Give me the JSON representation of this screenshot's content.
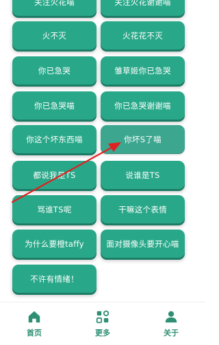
{
  "buttons": [
    {
      "label": "关注火花喵"
    },
    {
      "label": "关注火花谢谢喵"
    },
    {
      "label": "火不灭"
    },
    {
      "label": "火花花不灭"
    },
    {
      "label": "你已急哭"
    },
    {
      "label": "雏草姬你已急哭"
    },
    {
      "label": "你已急哭喵"
    },
    {
      "label": "你已急哭谢谢喵"
    },
    {
      "label": "你这个坏东西喵"
    },
    {
      "label": "你坏S了喵"
    },
    {
      "label": "都说我是TS"
    },
    {
      "label": "说谁是TS"
    },
    {
      "label": "骂谁TS呢"
    },
    {
      "label": "干嘛这个表情"
    },
    {
      "label": "为什么要橙taffy"
    },
    {
      "label": "面对摄像头要开心喵"
    },
    {
      "label": "不许有情绪！"
    }
  ],
  "nav": {
    "home": "首页",
    "more": "更多",
    "about": "关于"
  },
  "colors": {
    "button": "#29a889",
    "nav_icon": "#2f8f74",
    "arrow": "#e02020"
  },
  "icons": {
    "home": "home-icon",
    "more": "apps-icon",
    "about": "person-icon"
  }
}
